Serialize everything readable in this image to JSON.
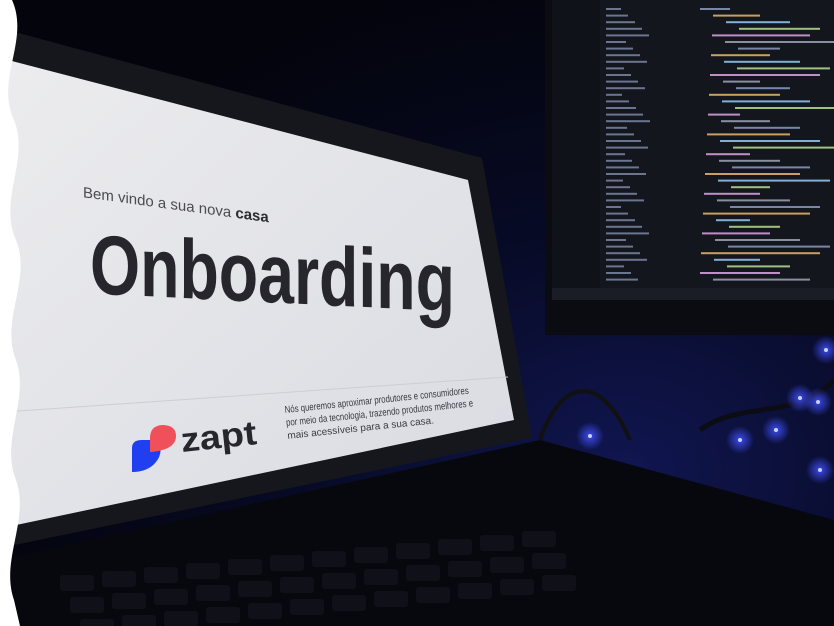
{
  "screen": {
    "welcome_prefix": "Bem vindo a sua nova ",
    "welcome_bold": "casa",
    "title": "Onboarding",
    "description": [
      "Nós queremos aproximar produtores e consumidores",
      "por meio da tecnologia, trazendo produtos melhores e",
      "mais acessíveis para a sua casa."
    ],
    "logo_text": "zapt"
  },
  "colors": {
    "logo_red": "#f0505a",
    "logo_blue": "#1f3ff0",
    "screen_bg": "#e4e5e9",
    "text_dark": "#26262c",
    "led_blue": "#3a4cff"
  }
}
